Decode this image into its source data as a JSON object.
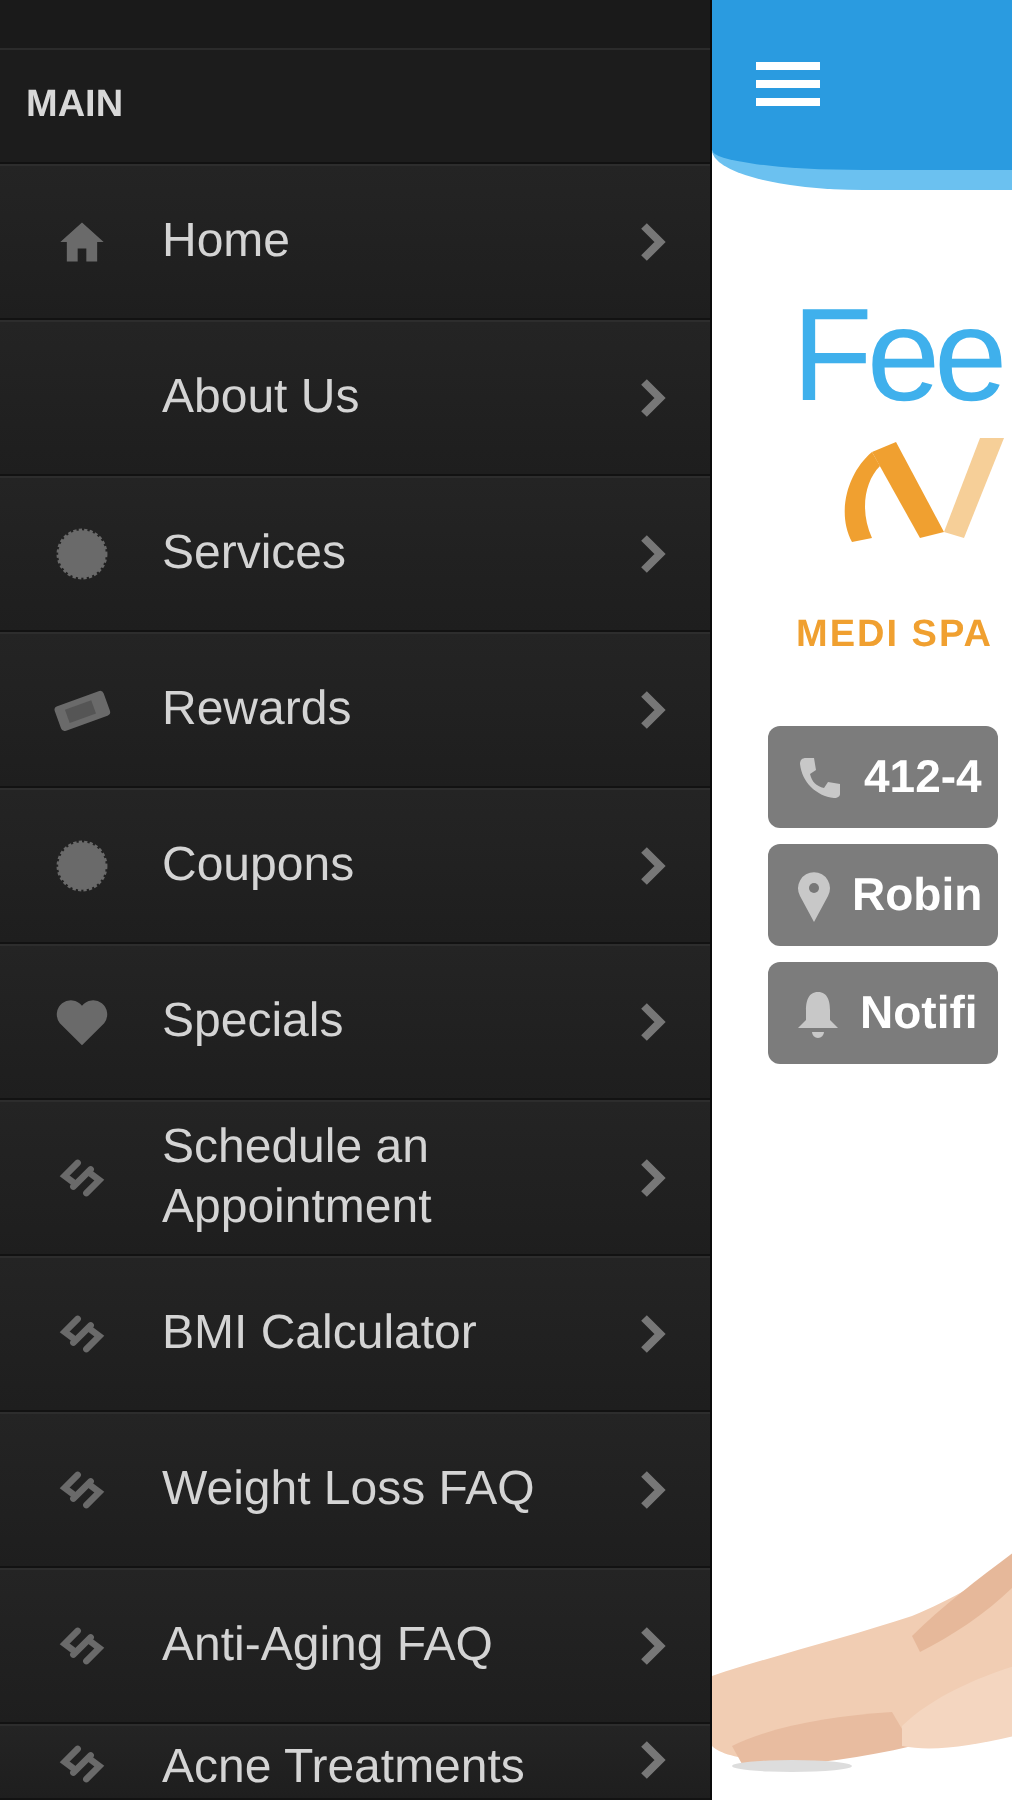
{
  "drawer": {
    "section": "MAIN",
    "items": [
      {
        "label": "Home",
        "kind": "home"
      },
      {
        "label": "About Us",
        "kind": "plain"
      },
      {
        "label": "Services",
        "kind": "seal"
      },
      {
        "label": "Rewards",
        "kind": "ticket"
      },
      {
        "label": "Coupons",
        "kind": "seal"
      },
      {
        "label": "Specials",
        "kind": "heart"
      },
      {
        "label": "Schedule an Appointment",
        "kind": "link"
      },
      {
        "label": "BMI Calculator",
        "kind": "link"
      },
      {
        "label": "Weight Loss FAQ",
        "kind": "link"
      },
      {
        "label": "Anti-Aging FAQ",
        "kind": "link"
      },
      {
        "label": "Acne Treatments",
        "kind": "link"
      }
    ]
  },
  "content": {
    "logo_text": "Fee",
    "tagline": "MEDI SPA",
    "buttons": [
      {
        "label": "412-4",
        "kind": "phone"
      },
      {
        "label": "Robin",
        "kind": "pin"
      },
      {
        "label": "Notifi",
        "kind": "bell"
      }
    ]
  }
}
